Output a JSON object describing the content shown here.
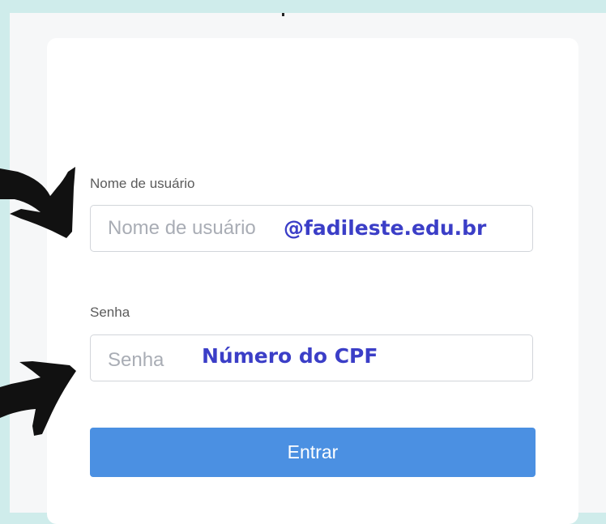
{
  "form": {
    "username": {
      "label": "Nome de usuário",
      "placeholder": "Nome de usuário",
      "hint": "@fadileste.edu.br"
    },
    "password": {
      "label": "Senha",
      "placeholder": "Senha",
      "hint": "Número do CPF"
    },
    "submit_label": "Entrar"
  },
  "colors": {
    "background": "#cfeceb",
    "panel": "#f6f7f8",
    "card": "#ffffff",
    "button": "#4b90e2",
    "hint_text": "#3b3ec7",
    "arrow": "#111111"
  },
  "icons": [
    "arrow-to-username-icon",
    "arrow-to-password-icon"
  ]
}
